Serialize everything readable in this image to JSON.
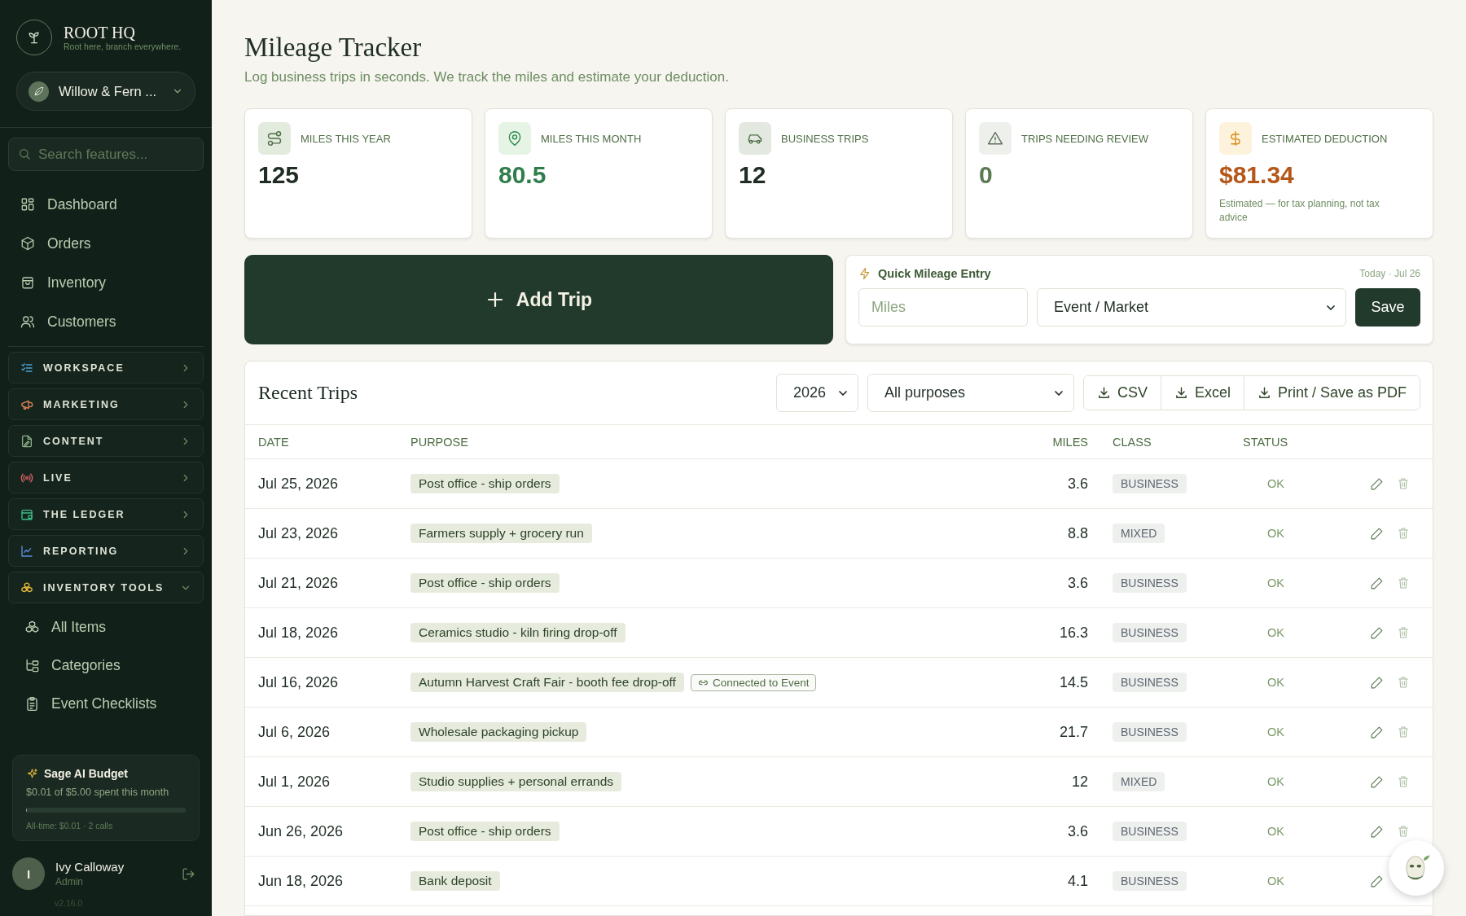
{
  "brand": {
    "name": "ROOT HQ",
    "tagline": "Root here, branch everywhere."
  },
  "workspace_switcher": {
    "label": "Willow & Fern ..."
  },
  "sidebar_search": {
    "placeholder": "Search features..."
  },
  "nav_items": [
    {
      "label": "Dashboard"
    },
    {
      "label": "Orders"
    },
    {
      "label": "Inventory"
    },
    {
      "label": "Customers"
    }
  ],
  "sections": [
    {
      "label": "WORKSPACE",
      "expanded": false
    },
    {
      "label": "MARKETING",
      "expanded": false
    },
    {
      "label": "CONTENT",
      "expanded": false
    },
    {
      "label": "LIVE",
      "expanded": false
    },
    {
      "label": "THE LEDGER",
      "expanded": false
    },
    {
      "label": "REPORTING",
      "expanded": false
    },
    {
      "label": "INVENTORY TOOLS",
      "expanded": true,
      "children": [
        {
          "label": "All Items"
        },
        {
          "label": "Categories"
        },
        {
          "label": "Event Checklists"
        }
      ]
    }
  ],
  "ai_budget": {
    "title": "Sage AI Budget",
    "spent": "$0.01 of $5.00 spent this month",
    "level": 0.002,
    "all_time": "All-time: $0.01 · 2 calls"
  },
  "user": {
    "initial": "I",
    "name": "Ivy Calloway",
    "role": "Admin"
  },
  "version": "v2.16.0",
  "page": {
    "title": "Mileage Tracker",
    "subtitle": "Log business trips in seconds. We track the miles and estimate your deduction."
  },
  "stats": [
    {
      "label": "MILES THIS YEAR",
      "value": "125",
      "color": "#1f2d24"
    },
    {
      "label": "MILES THIS MONTH",
      "value": "80.5",
      "color": "#2e7d4a"
    },
    {
      "label": "BUSINESS TRIPS",
      "value": "12",
      "color": "#1f2d24"
    },
    {
      "label": "TRIPS NEEDING REVIEW",
      "value": "0",
      "color": "#5b7a52"
    },
    {
      "label": "ESTIMATED DEDUCTION",
      "value": "$81.34",
      "color": "#b5561a",
      "note": "Estimated — for tax planning, not tax advice"
    }
  ],
  "add_trip_button": {
    "label": "Add Trip"
  },
  "quick_entry": {
    "title": "Quick Mileage Entry",
    "date": "Today · Jul 26",
    "miles_placeholder": "Miles",
    "purpose_value": "Event / Market",
    "save_label": "Save"
  },
  "recent_trips": {
    "title": "Recent Trips",
    "year_filter": "2026",
    "purpose_filter": "All purposes",
    "exports": [
      "CSV",
      "Excel",
      "Print / Save as PDF"
    ],
    "columns": [
      "DATE",
      "PURPOSE",
      "MILES",
      "CLASS",
      "STATUS"
    ],
    "rows": [
      {
        "date": "Jul 25, 2026",
        "purpose": "Post office - ship orders",
        "miles": "3.6",
        "class": "BUSINESS",
        "status": "OK"
      },
      {
        "date": "Jul 23, 2026",
        "purpose": "Farmers supply + grocery run",
        "miles": "8.8",
        "class": "MIXED",
        "status": "OK"
      },
      {
        "date": "Jul 21, 2026",
        "purpose": "Post office - ship orders",
        "miles": "3.6",
        "class": "BUSINESS",
        "status": "OK"
      },
      {
        "date": "Jul 18, 2026",
        "purpose": "Ceramics studio - kiln firing drop-off",
        "miles": "16.3",
        "class": "BUSINESS",
        "status": "OK"
      },
      {
        "date": "Jul 16, 2026",
        "purpose": "Autumn Harvest Craft Fair - booth fee drop-off",
        "event_link": "Connected to Event",
        "miles": "14.5",
        "class": "BUSINESS",
        "status": "OK"
      },
      {
        "date": "Jul 6, 2026",
        "purpose": "Wholesale packaging pickup",
        "miles": "21.7",
        "class": "BUSINESS",
        "status": "OK"
      },
      {
        "date": "Jul 1, 2026",
        "purpose": "Studio supplies + personal errands",
        "miles": "12",
        "class": "MIXED",
        "status": "OK"
      },
      {
        "date": "Jun 26, 2026",
        "purpose": "Post office - ship orders",
        "miles": "3.6",
        "class": "BUSINESS",
        "status": "OK"
      },
      {
        "date": "Jun 18, 2026",
        "purpose": "Bank deposit",
        "miles": "4.1",
        "class": "BUSINESS",
        "status": "OK"
      }
    ]
  }
}
